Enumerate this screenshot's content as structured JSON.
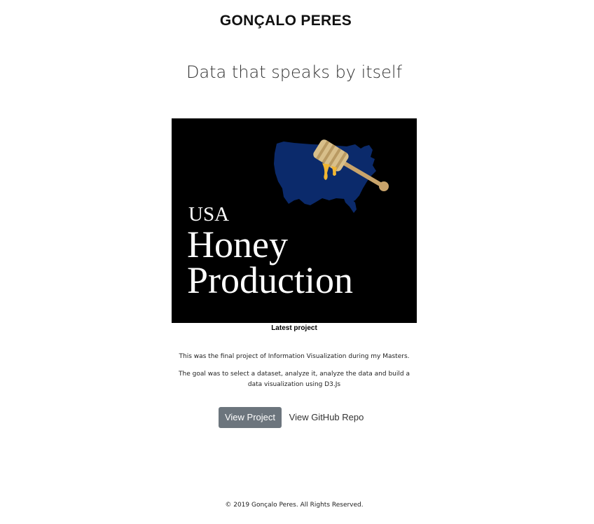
{
  "header": {
    "site_title": "GONÇALO PERES"
  },
  "hero": {
    "tagline": "Data that speaks by itself"
  },
  "project": {
    "image": {
      "line_1": "USA",
      "line_2": "Honey",
      "line_3": "Production",
      "background_color": "#000000",
      "map_color": "#0b2a6b",
      "dipper_color": "#d8bf8a",
      "honey_color": "#f2b632"
    },
    "caption": "Latest project",
    "description_1": "This was the final project of Information Visualization during my Masters.",
    "description_2": "The goal was to select a dataset, analyze it, analyze the data and build a data visualization using D3.Js",
    "view_project_label": "View Project",
    "view_repo_label": "View GitHub Repo"
  },
  "footer": {
    "copyright": "© 2019 Gonçalo Peres. All Rights Reserved."
  },
  "colors": {
    "button_bg": "#6c757d",
    "button_text": "#ffffff"
  }
}
